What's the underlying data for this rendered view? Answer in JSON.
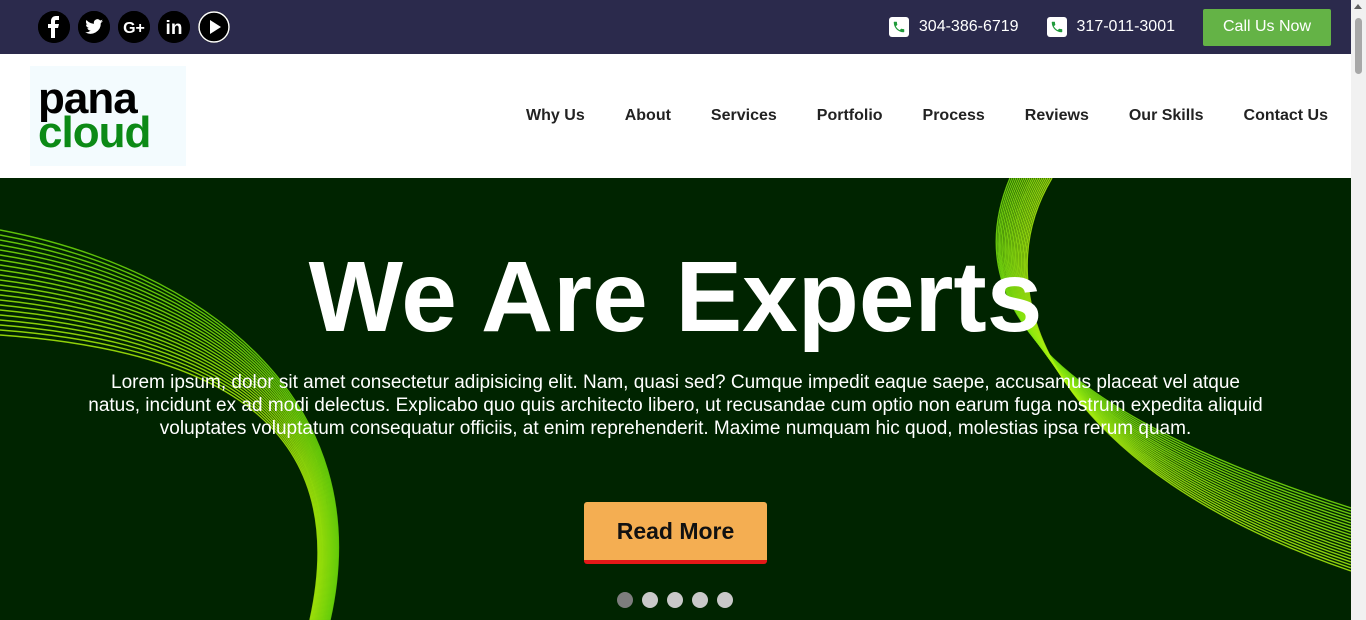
{
  "topbar": {
    "social": [
      {
        "name": "facebook-icon",
        "glyph": "f"
      },
      {
        "name": "twitter-icon",
        "glyph": ""
      },
      {
        "name": "google-plus-icon",
        "glyph": "G+"
      },
      {
        "name": "linkedin-icon",
        "glyph": "in"
      },
      {
        "name": "youtube-icon",
        "glyph": ""
      }
    ],
    "phones": [
      "304-386-6719",
      "317-011-3001"
    ],
    "call_label": "Call Us Now",
    "call_color": "#64b346",
    "bg_color": "#2b2a4c"
  },
  "header": {
    "logo_top": "pana",
    "logo_bottom": "cloud",
    "nav": [
      "Why Us",
      "About",
      "Services",
      "Portfolio",
      "Process",
      "Reviews",
      "Our Skills",
      "Contact Us"
    ]
  },
  "hero": {
    "title": "We Are Experts",
    "text": "Lorem ipsum, dolor sit amet consectetur adipisicing elit. Nam, quasi sed? Cumque impedit eaque saepe, accusamus placeat vel atque natus, incidunt ex ad modi delectus. Explicabo quo quis architecto libero, ut recusandae cum optio non earum fuga nostrum expedita aliquid voluptates voluptatum consequatur officiis, at enim reprehenderit. Maxime numquam hic quod, molestias ipsa rerum quam.",
    "button_label": "Read More",
    "slide_count": 5,
    "active_slide": 1,
    "bg_color": "#002400",
    "accent_color": "#f4ae52"
  }
}
